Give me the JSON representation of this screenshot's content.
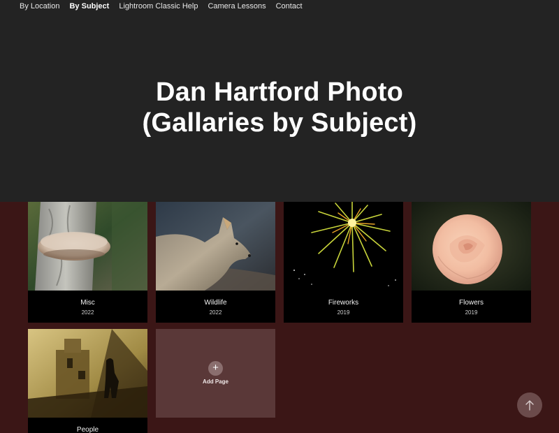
{
  "nav": {
    "items": [
      {
        "label": "By Location",
        "active": false
      },
      {
        "label": "By Subject",
        "active": true
      },
      {
        "label": "Lightroom Classic Help",
        "active": false
      },
      {
        "label": "Camera Lessons",
        "active": false
      },
      {
        "label": "Contact",
        "active": false
      }
    ]
  },
  "header": {
    "title_line1": "Dan Hartford Photo",
    "title_line2": "(Gallaries by Subject)"
  },
  "galleries": [
    {
      "title": "Misc",
      "year": "2022"
    },
    {
      "title": "Wildlife",
      "year": "2022"
    },
    {
      "title": "Fireworks",
      "year": "2019"
    },
    {
      "title": "Flowers",
      "year": "2019"
    },
    {
      "title": "People",
      "year": ""
    }
  ],
  "add_page": {
    "icon": "plus-icon",
    "label": "Add Page"
  },
  "scroll_top": {
    "icon": "arrow-up-icon"
  },
  "colors": {
    "header_bg": "#232323",
    "page_bg": "#3b1616",
    "card_bg": "#000000",
    "add_card_bg": "#5a3838"
  }
}
